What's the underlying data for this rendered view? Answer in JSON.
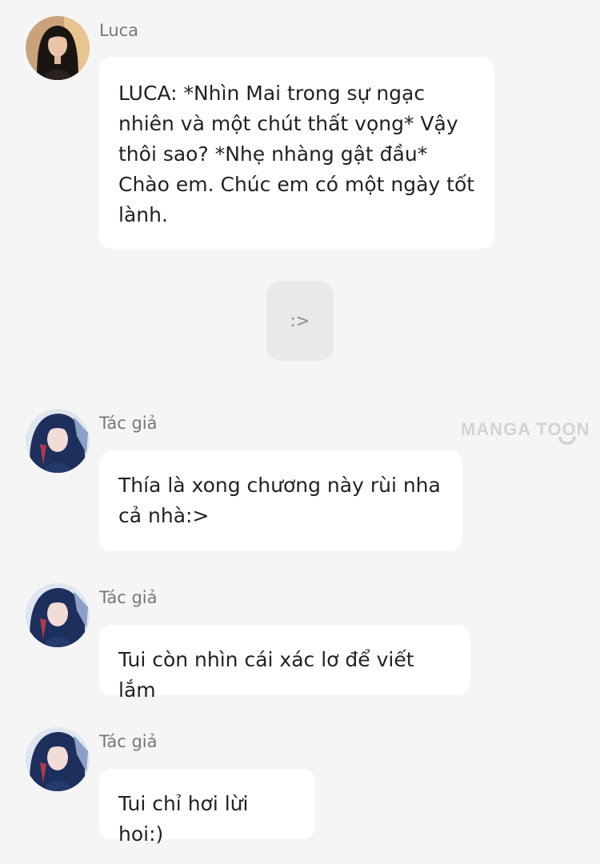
{
  "messages": [
    {
      "sender": "Luca",
      "avatar": "luca-avatar",
      "text": "LUCA: *Nhìn Mai trong sự ngạc\nnhiên và một chút thất vọng* Vậy\nthôi sao? *Nhẹ nhàng gật đầu*\nChào em. Chúc em có một ngày tốt\nlành."
    },
    {
      "system_text": ":>"
    },
    {
      "sender": "Tác giả",
      "avatar": "author-avatar",
      "text": "Thía là xong chương này rùi nha\ncả nhà:>"
    },
    {
      "sender": "Tác giả",
      "avatar": "author-avatar",
      "text": "Tui còn nhìn cái xác lơ để viết lắm"
    },
    {
      "sender": "Tác giả",
      "avatar": "author-avatar",
      "text": "Tui chỉ hơi lừi hoi:)"
    }
  ],
  "watermark": "MANGA TOON",
  "colors": {
    "background": "#f5f5f5",
    "bubble": "#ffffff",
    "system_bubble": "#e9e9e9",
    "text": "#222222",
    "sender": "#777777"
  }
}
